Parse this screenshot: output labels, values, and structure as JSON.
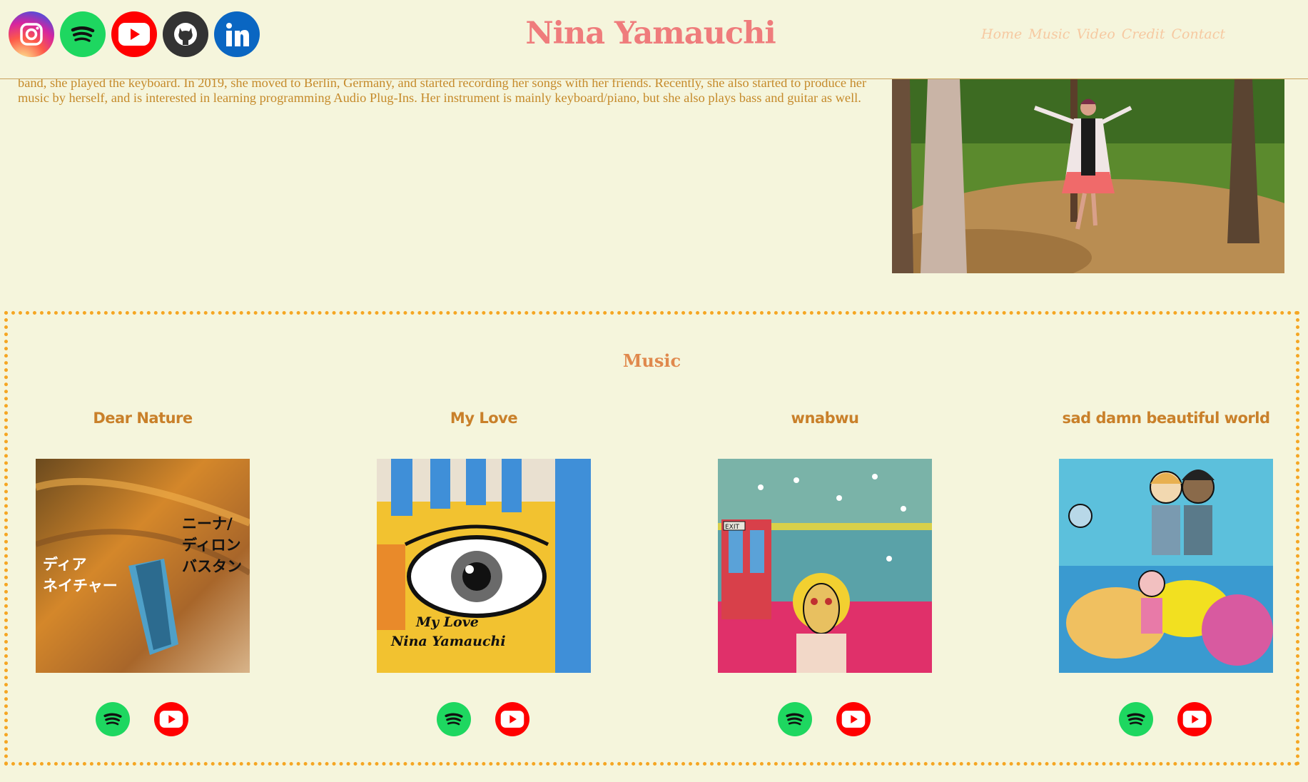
{
  "header": {
    "title": "Nina Yamauchi",
    "social": [
      {
        "icon": "instagram-icon",
        "name": "instagram-button",
        "color": "#dd2a7b"
      },
      {
        "icon": "spotify-icon",
        "name": "spotify-button",
        "color": "#1ed760"
      },
      {
        "icon": "youtube-icon",
        "name": "youtube-button",
        "color": "#ff0000"
      },
      {
        "icon": "github-icon",
        "name": "github-button",
        "color": "#333333"
      },
      {
        "icon": "linkedin-icon",
        "name": "linkedin-button",
        "color": "#0a66c2"
      }
    ],
    "nav": [
      "Home",
      "Music",
      "Video",
      "Credit",
      "Contact"
    ]
  },
  "about": {
    "text": "continue her music career abroad. In Melbourne, she performed a lot on the streets. Then she moved to Toronto, Canada, and joined the band Human Magic. In the band, she played the keyboard. In 2019, she moved to Berlin, Germany, and started recording her songs with her friends. Recently, she also started to produce her music by herself, and is interested in learning programming Audio Plug-Ins. Her instrument is mainly keyboard/piano, but she also plays bass and guitar as well."
  },
  "music": {
    "title": "Music",
    "releases": [
      {
        "name": "Dear Nature",
        "cover_text": [
          "ニーナ/",
          "ディロン",
          "バスタン",
          "ディア",
          "ネイチャー"
        ]
      },
      {
        "name": "My Love",
        "cover_text": [
          "My Love",
          "Nina Yamauchi"
        ]
      },
      {
        "name": "wnabwu",
        "cover_text": [
          "EXIT"
        ]
      },
      {
        "name": "sad damn beautiful world",
        "cover_text": []
      }
    ]
  },
  "colors": {
    "background": "#f5f5dc",
    "title": "#ef7c7c",
    "nav": "#f6c9a1",
    "body_text": "#c58a2a",
    "section_border": "#f5a623",
    "release_name": "#c9802a"
  }
}
